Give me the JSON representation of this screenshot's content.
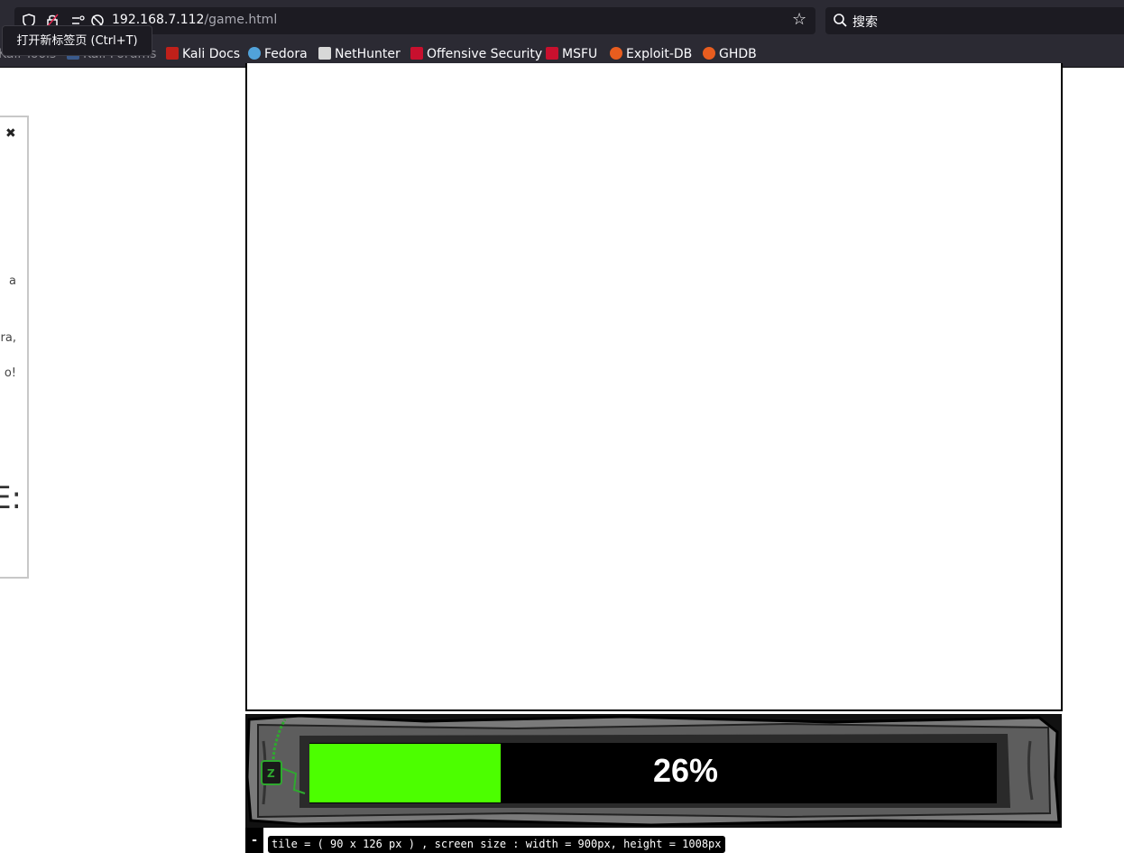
{
  "browser": {
    "url_host": "192.168.7.112",
    "url_path": "/game.html",
    "search_placeholder": "搜索",
    "tooltip": "打开新标签页 (Ctrl+T)",
    "bookmarks": [
      {
        "label": "Kali Tools"
      },
      {
        "label": "Kali Forums"
      },
      {
        "label": "Kali Docs"
      },
      {
        "label": "Fedora"
      },
      {
        "label": "NetHunter"
      },
      {
        "label": "Offensive Security"
      },
      {
        "label": "MSFU"
      },
      {
        "label": "Exploit-DB"
      },
      {
        "label": "GHDB"
      }
    ]
  },
  "side_panel": {
    "close_symbol": "✖",
    "fragments": [
      "a",
      "ra,",
      "o!"
    ],
    "big_text": "E:"
  },
  "loader": {
    "progress_percent": 26,
    "progress_label": "26%",
    "fill_color": "#4cff00"
  },
  "footer": {
    "minus_label": "-",
    "status": "tile = ( 90 x 126 px ) , screen size : width = 900px, height = 1008px"
  }
}
